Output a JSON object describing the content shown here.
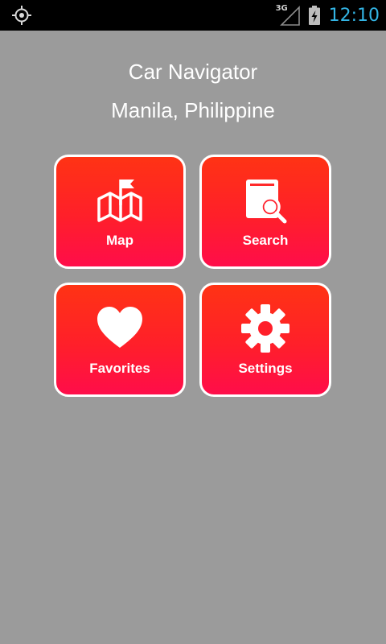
{
  "status_bar": {
    "network": "3G",
    "time": "12:10",
    "clock_color": "#33b5e5",
    "icons": [
      "gps-icon",
      "signal-icon",
      "battery-charging-icon"
    ]
  },
  "header": {
    "title": "Car Navigator",
    "subtitle": "Manila, Philippine"
  },
  "menu": {
    "tiles": [
      {
        "label": "Map",
        "icon": "map-icon"
      },
      {
        "label": "Search",
        "icon": "search-icon"
      },
      {
        "label": "Favorites",
        "icon": "heart-icon"
      },
      {
        "label": "Settings",
        "icon": "gear-icon"
      }
    ]
  },
  "colors": {
    "background": "#9b9b9b",
    "tile_top": "#ff3314",
    "tile_bottom": "#ff0d4a",
    "tile_border": "#ffffff"
  }
}
